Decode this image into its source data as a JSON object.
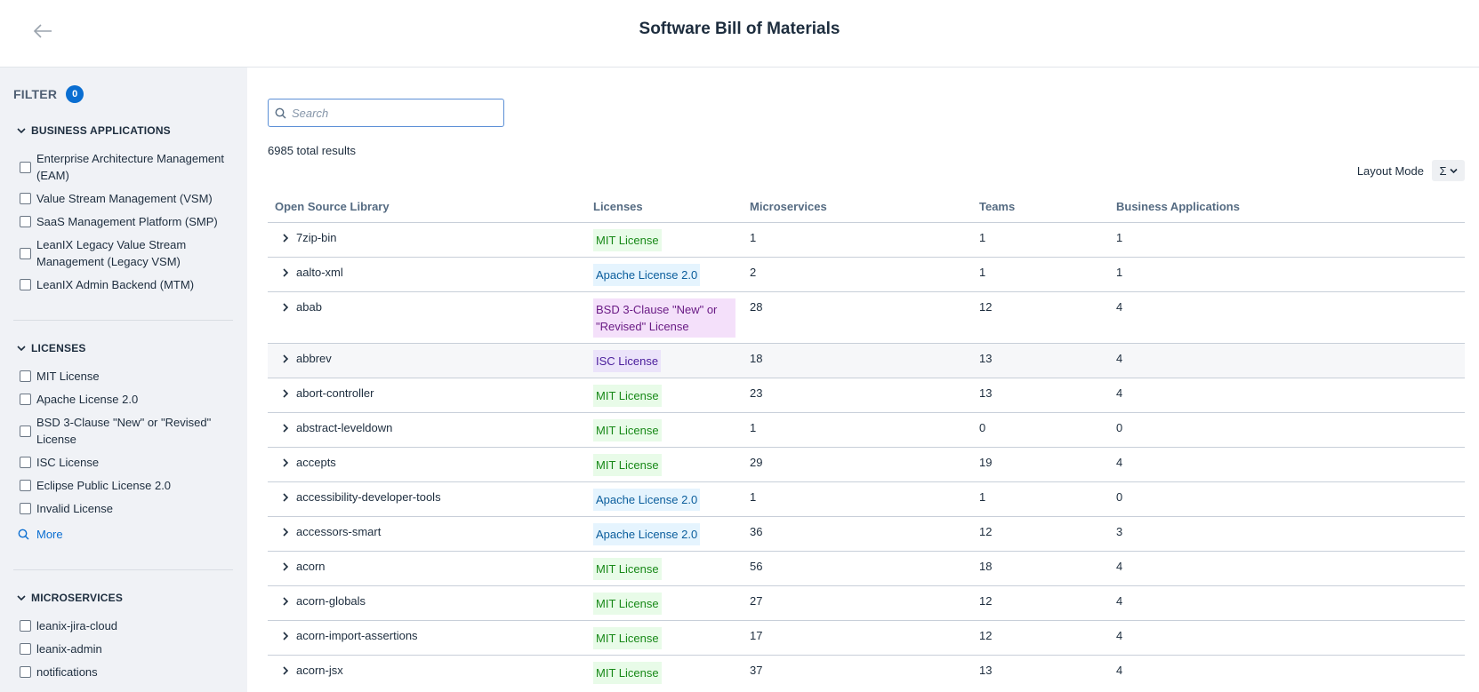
{
  "header": {
    "title": "Software Bill of Materials",
    "back_icon": "arrow-left-icon"
  },
  "sidebar": {
    "filter_label": "FILTER",
    "filter_count": "0",
    "sections": [
      {
        "title": "BUSINESS APPLICATIONS",
        "options": [
          "Enterprise Architecture Management (EAM)",
          "Value Stream Management (VSM)",
          "SaaS Management Platform (SMP)",
          "LeanIX Legacy Value Stream Management (Legacy VSM)",
          "LeanIX Admin Backend (MTM)"
        ]
      },
      {
        "title": "LICENSES",
        "options": [
          "MIT License",
          "Apache License 2.0",
          "BSD 3-Clause \"New\" or \"Revised\" License",
          "ISC License",
          "Eclipse Public License 2.0",
          "Invalid License"
        ],
        "more_label": "More"
      },
      {
        "title": "MICROSERVICES",
        "options": [
          "leanix-jira-cloud",
          "leanix-admin",
          "notifications"
        ]
      }
    ]
  },
  "main": {
    "search": {
      "placeholder": "Search",
      "value": ""
    },
    "results_count": "6985 total results",
    "layout_mode": {
      "label": "Layout Mode",
      "selected_symbol": "Σ"
    },
    "table": {
      "columns": [
        "Open Source Library",
        "Licenses",
        "Microservices",
        "Teams",
        "Business Applications"
      ],
      "rows": [
        {
          "library": "7zip-bin",
          "license": "MIT License",
          "license_type": "mit",
          "microservices": "1",
          "teams": "1",
          "business_applications": "1"
        },
        {
          "library": "aalto-xml",
          "license": "Apache License 2.0",
          "license_type": "apache",
          "microservices": "2",
          "teams": "1",
          "business_applications": "1"
        },
        {
          "library": "abab",
          "license": "BSD 3-Clause \"New\" or \"Revised\" License",
          "license_type": "bsd",
          "microservices": "28",
          "teams": "12",
          "business_applications": "4"
        },
        {
          "library": "abbrev",
          "license": "ISC License",
          "license_type": "isc",
          "microservices": "18",
          "teams": "13",
          "business_applications": "4"
        },
        {
          "library": "abort-controller",
          "license": "MIT License",
          "license_type": "mit",
          "microservices": "23",
          "teams": "13",
          "business_applications": "4"
        },
        {
          "library": "abstract-leveldown",
          "license": "MIT License",
          "license_type": "mit",
          "microservices": "1",
          "teams": "0",
          "business_applications": "0"
        },
        {
          "library": "accepts",
          "license": "MIT License",
          "license_type": "mit",
          "microservices": "29",
          "teams": "19",
          "business_applications": "4"
        },
        {
          "library": "accessibility-developer-tools",
          "license": "Apache License 2.0",
          "license_type": "apache",
          "microservices": "1",
          "teams": "1",
          "business_applications": "0"
        },
        {
          "library": "accessors-smart",
          "license": "Apache License 2.0",
          "license_type": "apache",
          "microservices": "36",
          "teams": "12",
          "business_applications": "3"
        },
        {
          "library": "acorn",
          "license": "MIT License",
          "license_type": "mit",
          "microservices": "56",
          "teams": "18",
          "business_applications": "4"
        },
        {
          "library": "acorn-globals",
          "license": "MIT License",
          "license_type": "mit",
          "microservices": "27",
          "teams": "12",
          "business_applications": "4"
        },
        {
          "library": "acorn-import-assertions",
          "license": "MIT License",
          "license_type": "mit",
          "microservices": "17",
          "teams": "12",
          "business_applications": "4"
        },
        {
          "library": "acorn-jsx",
          "license": "MIT License",
          "license_type": "mit",
          "microservices": "37",
          "teams": "13",
          "business_applications": "4"
        }
      ]
    }
  },
  "colors": {
    "accent": "#0a6ed1",
    "sidebar_bg": "#f0f2f6",
    "mit_bg": "#e8fbe8",
    "mit_fg": "#188918",
    "apache_bg": "#e5f4fe",
    "apache_fg": "#0a5d9c",
    "bsd_bg": "#f4e0fa",
    "bsd_fg": "#6a1b85",
    "isc_bg": "#ebe3fa",
    "isc_fg": "#4a1d9c"
  }
}
